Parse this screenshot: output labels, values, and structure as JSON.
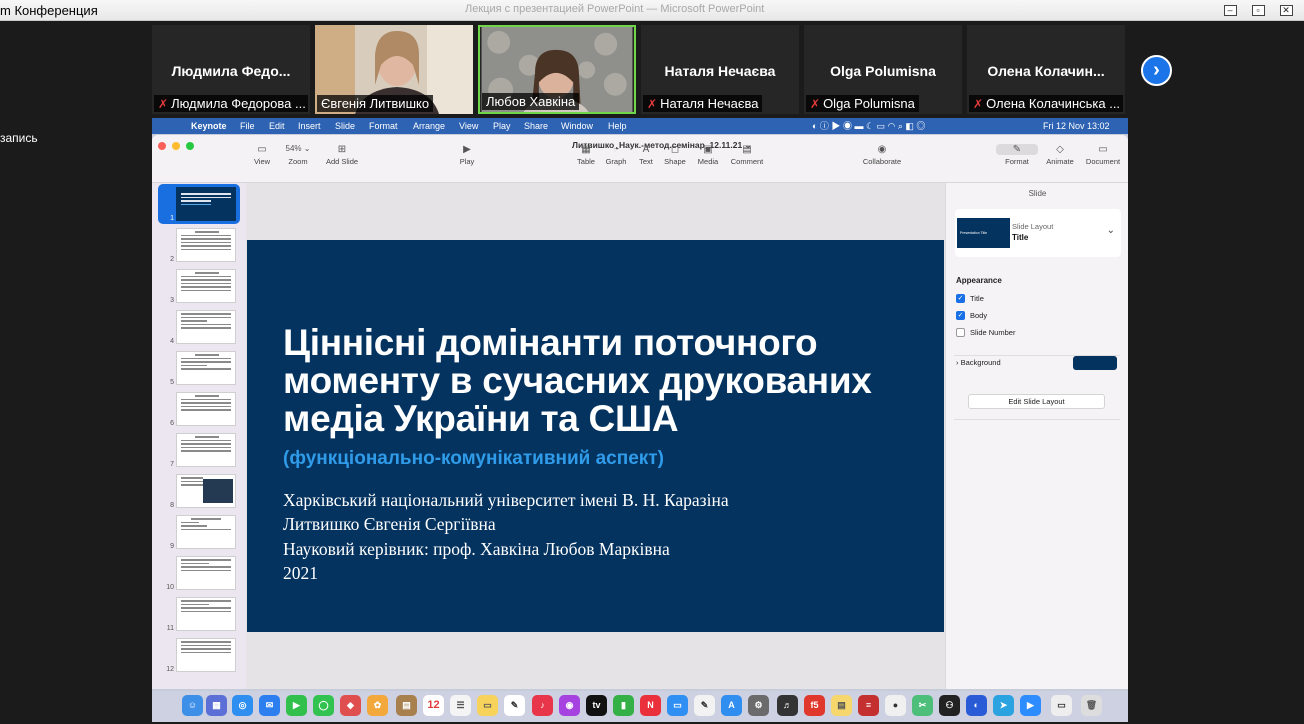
{
  "zoom": {
    "window_title": "m Конференция",
    "center_title": "Лекция с презентацией PowerPoint — Microsoft PowerPoint",
    "left_panel_text": "запись",
    "participants": [
      {
        "name": "Людмила  Федо...",
        "label": "Людмила Федорова ...",
        "muted": true
      },
      {
        "name": "",
        "label": "Євгенія Литвишко",
        "muted": false,
        "video": true
      },
      {
        "name": "",
        "label": "Любов Хавкіна",
        "muted": false,
        "video": true
      },
      {
        "name": "Наталя Нечаєва",
        "label": "Наталя Нечаєва",
        "muted": true
      },
      {
        "name": "Olga Polumisna",
        "label": "Olga Polumisna",
        "muted": true
      },
      {
        "name": "Олена  Колачин...",
        "label": "Олена Колачинська ...",
        "muted": true
      }
    ],
    "next_icon": "chevron-right-icon"
  },
  "mac": {
    "menu": [
      "Keynote",
      "File",
      "Edit",
      "Insert",
      "Slide",
      "Format",
      "Arrange",
      "View",
      "Play",
      "Share",
      "Window",
      "Help"
    ],
    "clock": "Fri 12 Nov  13:02",
    "doc_title": "Литвишко_Наук.-метод.семінар_12.11.21",
    "toolbar": {
      "view": "View",
      "zoom": "Zoom",
      "zoom_value": "54%",
      "add_slide": "Add Slide",
      "play": "Play",
      "table": "Table",
      "graph": "Graph",
      "text": "Text",
      "shape": "Shape",
      "media": "Media",
      "comment": "Comment",
      "collaborate": "Collaborate",
      "format": "Format",
      "animate": "Animate",
      "document": "Document"
    },
    "slide_numbers": [
      "1",
      "2",
      "3",
      "4",
      "5",
      "6",
      "7",
      "8",
      "9",
      "10",
      "11",
      "12"
    ],
    "slide": {
      "title": "Ціннісні домінанти поточного моменту в сучасних друкованих медіа України та США",
      "subtitle": "(функціонально-комунікативний аспект)",
      "lines": [
        "Харківський національний університет імені В. Н. Каразіна",
        "Литвишко Євгенія Сергіївна",
        "Науковий керівник: проф. Хавкіна Любов Марківна",
        "2021"
      ]
    },
    "inspector": {
      "header": "Slide",
      "layout_label": "Slide Layout",
      "layout_value": "Title",
      "layout_thumb_text": "Presentation Title",
      "appearance": "Appearance",
      "options": [
        {
          "label": "Title",
          "checked": true
        },
        {
          "label": "Body",
          "checked": true
        },
        {
          "label": "Slide Number",
          "checked": false
        }
      ],
      "background": "Background",
      "background_color": "#04335f",
      "edit_layout": "Edit Slide Layout"
    },
    "calendar_day": "12"
  }
}
